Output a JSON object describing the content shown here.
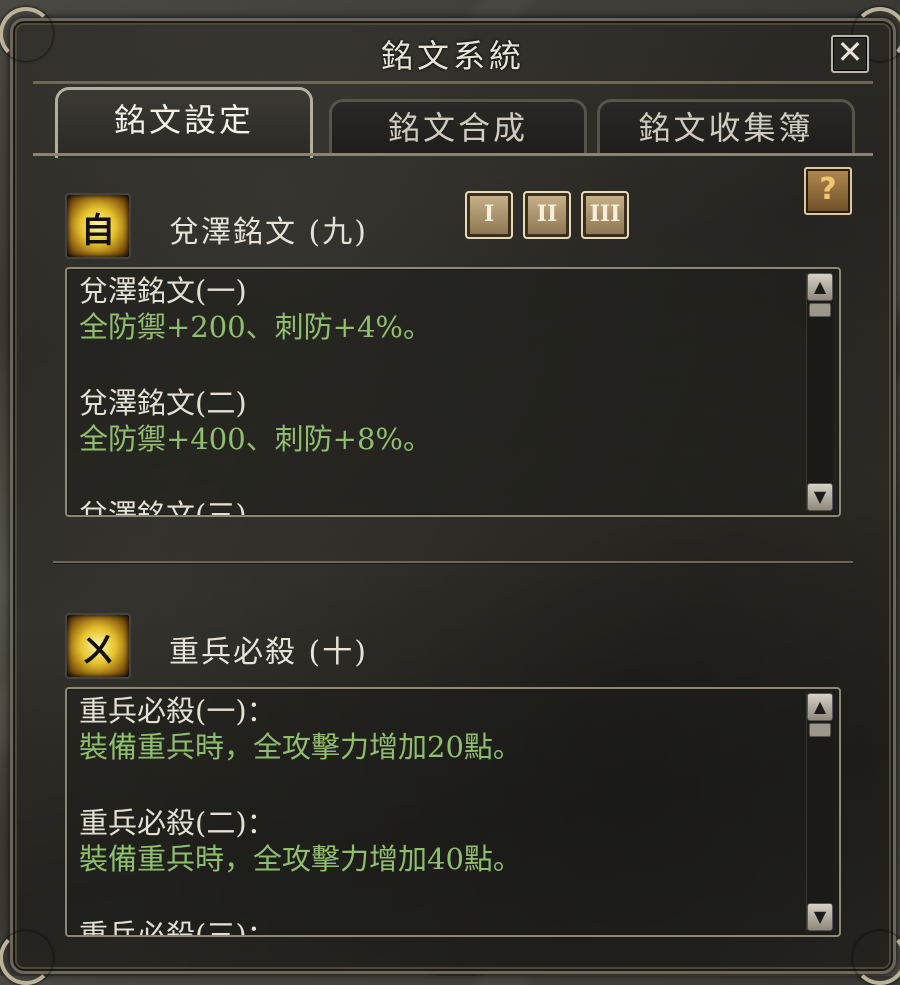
{
  "window": {
    "title": "銘文系統",
    "close_label": "✕"
  },
  "tabs": [
    {
      "label": "銘文設定",
      "active": true
    },
    {
      "label": "銘文合成",
      "active": false
    },
    {
      "label": "銘文收集簿",
      "active": false
    }
  ],
  "pages": [
    "I",
    "II",
    "III"
  ],
  "help_label": "?",
  "sections": [
    {
      "icon_glyph": "自",
      "title": "兌澤銘文 (九)",
      "entries": [
        {
          "name": "兌澤銘文(一)",
          "desc": "全防禦+200、刺防+4%。"
        },
        {
          "name": "兌澤銘文(二)",
          "desc": "全防禦+400、刺防+8%。"
        },
        {
          "name": "兌澤銘文(三)",
          "desc": ""
        }
      ]
    },
    {
      "icon_glyph": "ㄨ",
      "title": "重兵必殺 (十)",
      "entries": [
        {
          "name": "重兵必殺(一)：",
          "desc": "裝備重兵時，全攻擊力增加20點。"
        },
        {
          "name": "重兵必殺(二)：",
          "desc": "裝備重兵時，全攻擊力增加40點。"
        },
        {
          "name": "重兵必殺(三)：",
          "desc": ""
        }
      ]
    }
  ],
  "scroll": {
    "up": "▲",
    "down": "▼"
  }
}
